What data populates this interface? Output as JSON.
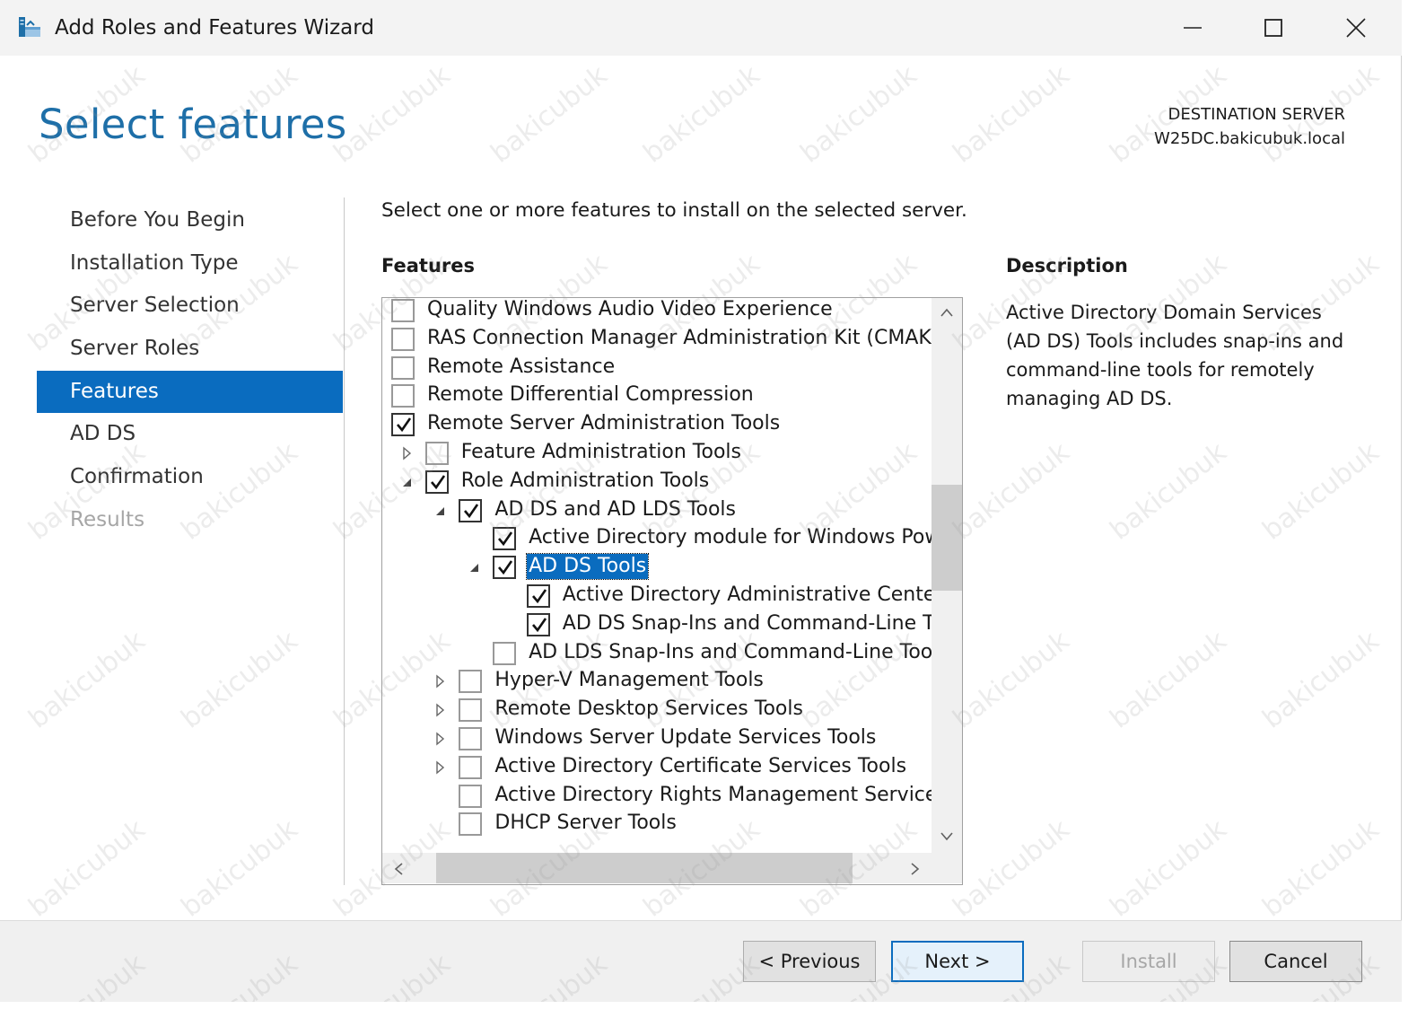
{
  "window": {
    "title": "Add Roles and Features Wizard"
  },
  "header": {
    "page_title": "Select features",
    "destination_label": "DESTINATION SERVER",
    "destination_server": "W25DC.bakicubuk.local"
  },
  "nav": {
    "items": [
      {
        "label": "Before You Begin",
        "state": "normal"
      },
      {
        "label": "Installation Type",
        "state": "normal"
      },
      {
        "label": "Server Selection",
        "state": "normal"
      },
      {
        "label": "Server Roles",
        "state": "normal"
      },
      {
        "label": "Features",
        "state": "active"
      },
      {
        "label": "AD DS",
        "state": "normal"
      },
      {
        "label": "Confirmation",
        "state": "normal"
      },
      {
        "label": "Results",
        "state": "disabled"
      }
    ]
  },
  "main": {
    "intro": "Select one or more features to install on the selected server.",
    "features_heading": "Features",
    "description_heading": "Description",
    "description_text": "Active Directory Domain Services (AD DS) Tools includes snap-ins and command-line tools for remotely managing AD DS."
  },
  "features": [
    {
      "label": "Quality Windows Audio Video Experience",
      "checked": false
    },
    {
      "label": "RAS Connection Manager Administration Kit (CMAK)",
      "checked": false
    },
    {
      "label": "Remote Assistance",
      "checked": false
    },
    {
      "label": "Remote Differential Compression",
      "checked": false
    },
    {
      "label": "Remote Server Administration Tools",
      "checked": true
    },
    {
      "label": "Feature Administration Tools",
      "checked": false,
      "expander": "collapsed"
    },
    {
      "label": "Role Administration Tools",
      "checked": true,
      "expander": "expanded"
    },
    {
      "label": "AD DS and AD LDS Tools",
      "checked": true,
      "expander": "expanded"
    },
    {
      "label": "Active Directory module for Windows PowerShell",
      "checked": true
    },
    {
      "label": "AD DS Tools",
      "checked": true,
      "expander": "expanded",
      "selected": true
    },
    {
      "label": "Active Directory Administrative Center",
      "checked": true
    },
    {
      "label": "AD DS Snap-Ins and Command-Line Tools",
      "checked": true
    },
    {
      "label": "AD LDS Snap-Ins and Command-Line Tools",
      "checked": false
    },
    {
      "label": "Hyper-V Management Tools",
      "checked": false,
      "expander": "collapsed"
    },
    {
      "label": "Remote Desktop Services Tools",
      "checked": false,
      "expander": "collapsed"
    },
    {
      "label": "Windows Server Update Services Tools",
      "checked": false,
      "expander": "collapsed"
    },
    {
      "label": "Active Directory Certificate Services Tools",
      "checked": false,
      "expander": "collapsed"
    },
    {
      "label": "Active Directory Rights Management Services Tools",
      "checked": false
    },
    {
      "label": "DHCP Server Tools",
      "checked": false
    }
  ],
  "buttons": {
    "previous": "< Previous",
    "next": "Next >",
    "install": "Install",
    "cancel": "Cancel"
  },
  "watermark": "bakicubuk"
}
